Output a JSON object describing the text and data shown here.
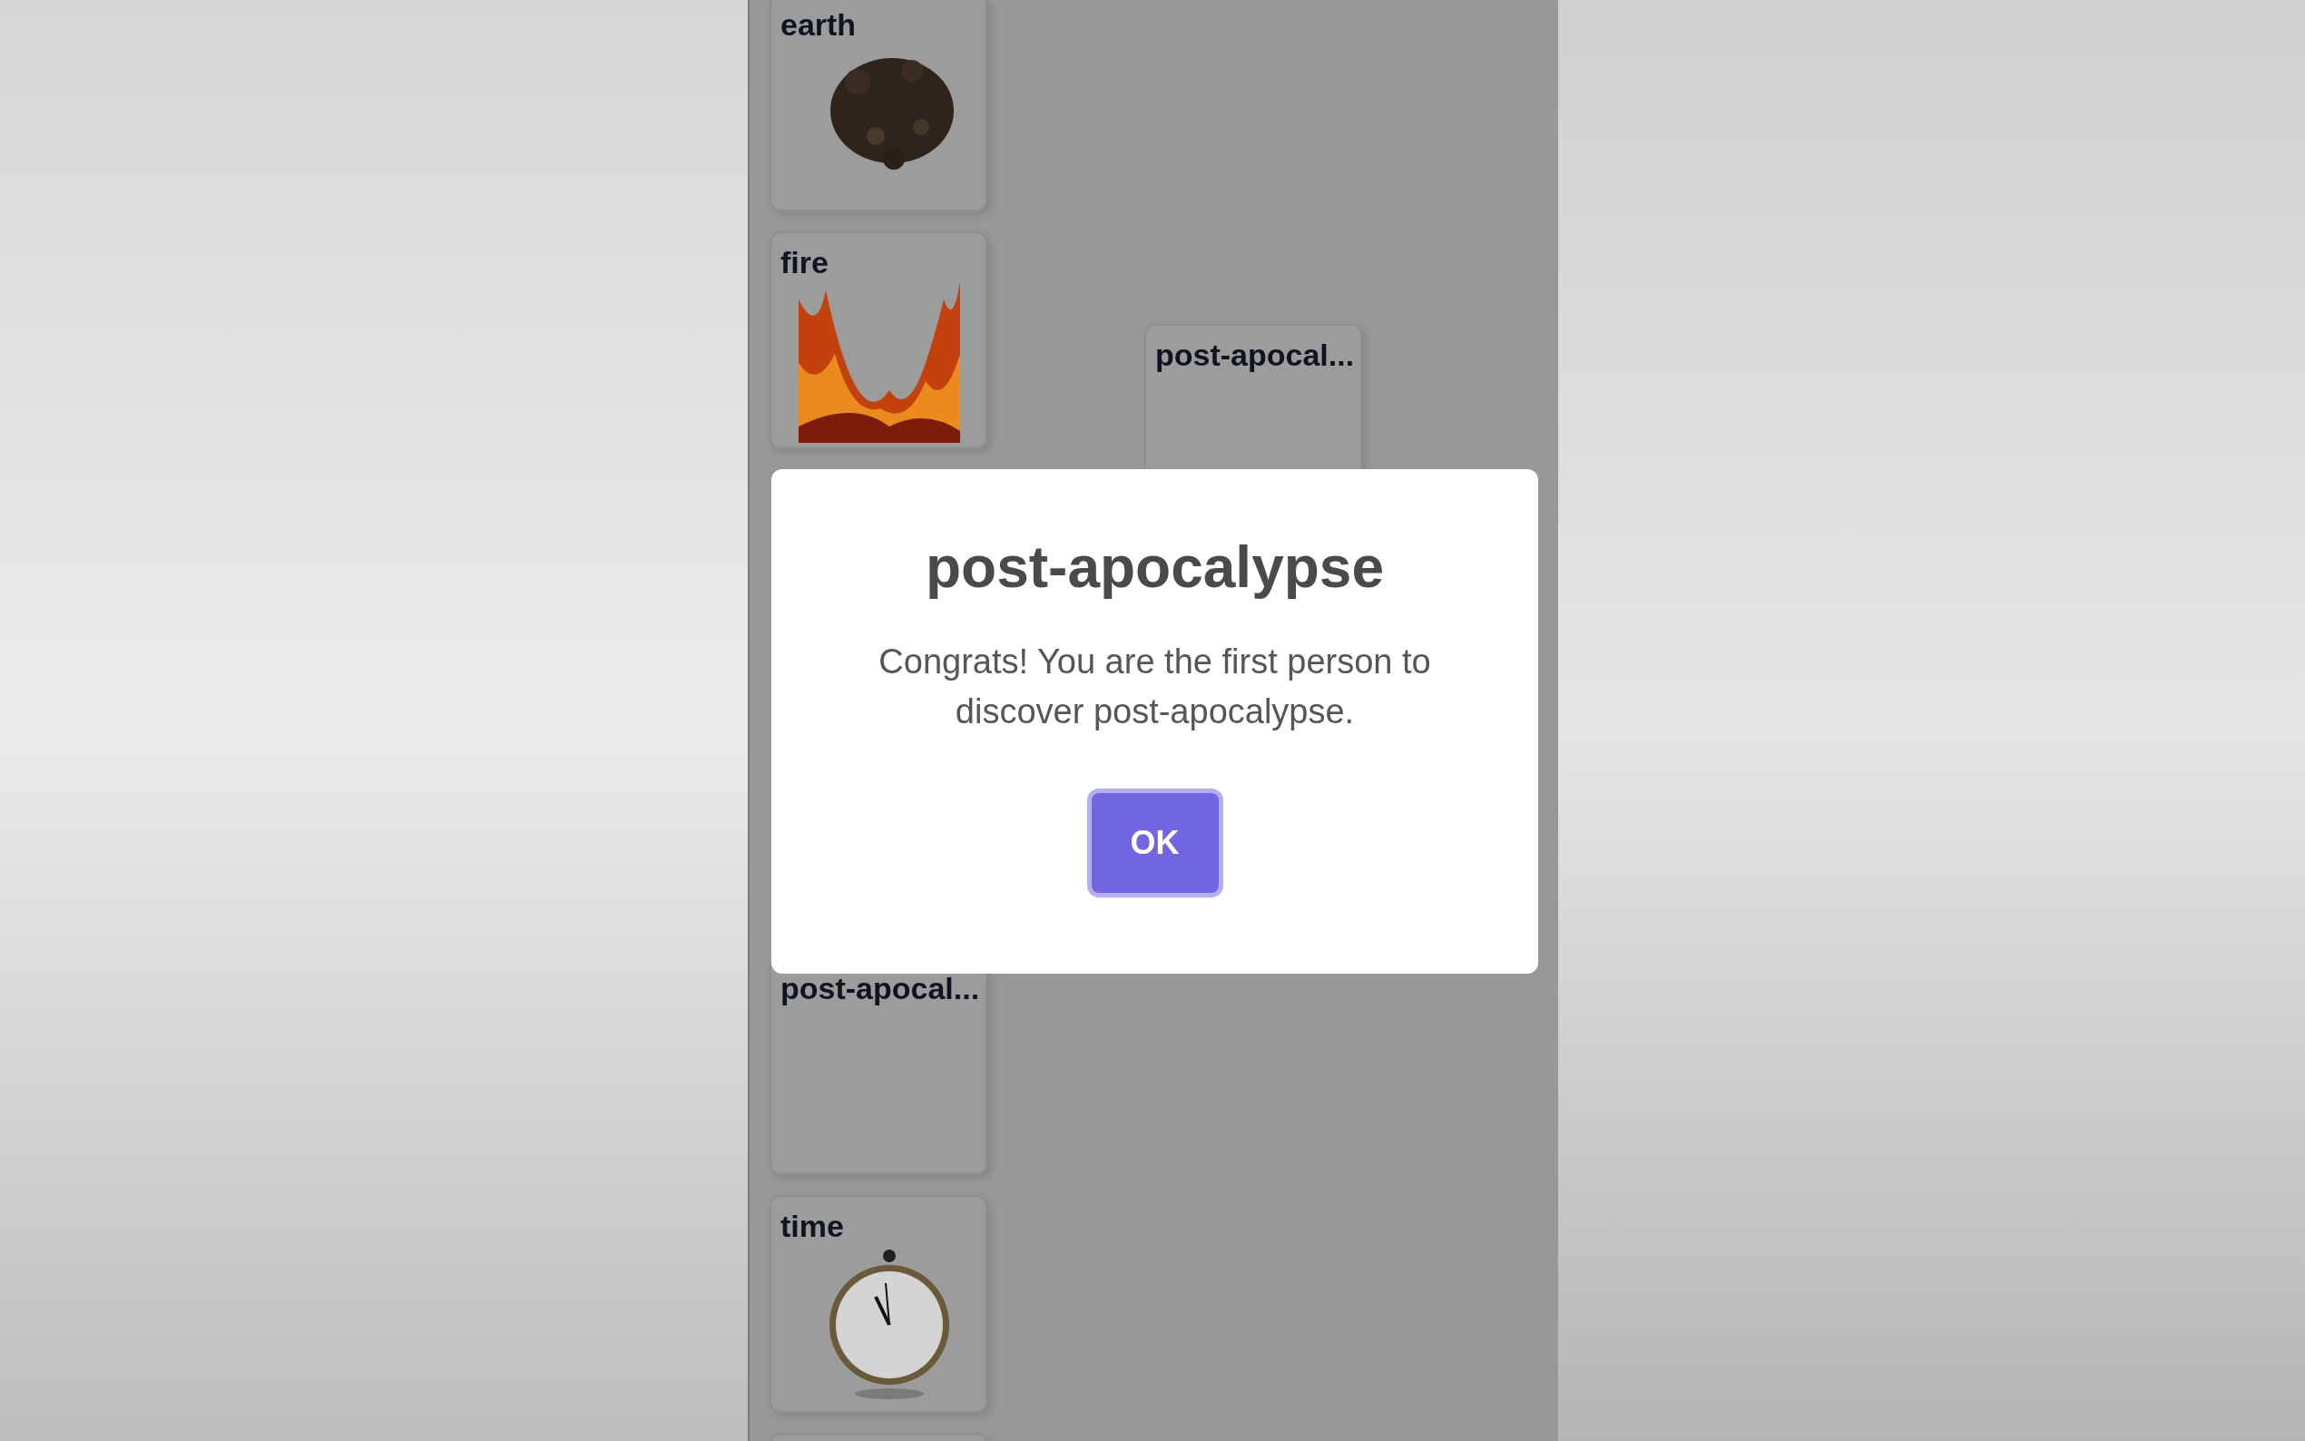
{
  "elements": [
    {
      "name": "earth",
      "kind": "earth"
    },
    {
      "name": "fire",
      "kind": "fire"
    },
    {
      "name": "post-apocal...",
      "kind": "blank"
    },
    {
      "name": "time",
      "kind": "clock"
    },
    {
      "kind": "blank"
    }
  ],
  "canvas_cards": [
    {
      "name": "post-apocal..."
    }
  ],
  "dialog": {
    "title": "post-apocalypse",
    "message": "Congrats! You are the first person to discover post-apocalypse.",
    "button": "OK"
  }
}
